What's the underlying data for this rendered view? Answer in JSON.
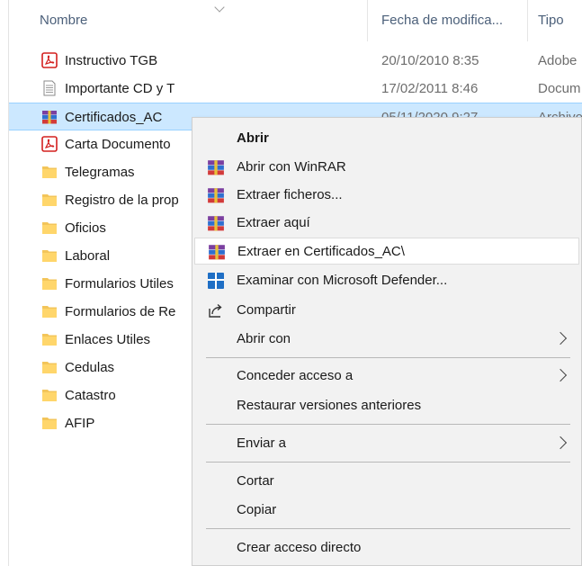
{
  "columns": {
    "name": "Nombre",
    "date": "Fecha de modifica...",
    "type": "Tipo"
  },
  "files": [
    {
      "name": "Instructivo TGB",
      "icon": "pdf-icon",
      "date": "20/10/2010 8:35",
      "type": "Adobe"
    },
    {
      "name": "Importante CD y T",
      "icon": "text-document-icon",
      "date": "17/02/2011 8:46",
      "type": "Docum"
    },
    {
      "name": "Certificados_AC",
      "icon": "winrar-archive-icon",
      "date": "05/11/2020 9:27",
      "type": "Archivo",
      "selected": true
    },
    {
      "name": "Carta Documento",
      "icon": "pdf-icon",
      "date": "",
      "type": ""
    },
    {
      "name": "Telegramas",
      "icon": "folder-icon",
      "date": "",
      "type": ""
    },
    {
      "name": "Registro de la prop",
      "icon": "folder-icon",
      "date": "",
      "type": ""
    },
    {
      "name": "Oficios",
      "icon": "folder-icon",
      "date": "",
      "type": ""
    },
    {
      "name": "Laboral",
      "icon": "folder-icon",
      "date": "",
      "type": ""
    },
    {
      "name": "Formularios Utiles",
      "icon": "folder-icon",
      "date": "",
      "type": ""
    },
    {
      "name": "Formularios de Re",
      "icon": "folder-icon",
      "date": "",
      "type": ""
    },
    {
      "name": "Enlaces Utiles",
      "icon": "folder-icon",
      "date": "",
      "type": ""
    },
    {
      "name": "Cedulas",
      "icon": "folder-icon",
      "date": "",
      "type": ""
    },
    {
      "name": "Catastro",
      "icon": "folder-icon",
      "date": "",
      "type": ""
    },
    {
      "name": "AFIP",
      "icon": "folder-icon",
      "date": "",
      "type": ""
    }
  ],
  "context_menu": {
    "items": [
      {
        "label": "Abrir",
        "bold": true,
        "icon": ""
      },
      {
        "label": "Abrir con WinRAR",
        "icon": "winrar-icon"
      },
      {
        "label": "Extraer ficheros...",
        "icon": "winrar-icon"
      },
      {
        "label": "Extraer aquí",
        "icon": "winrar-icon"
      },
      {
        "label": "Extraer en Certificados_AC\\",
        "icon": "winrar-icon",
        "hover": true
      },
      {
        "label": "Examinar con Microsoft Defender...",
        "icon": "defender-shield-icon"
      },
      {
        "label": "Compartir",
        "icon": "share-icon"
      },
      {
        "label": "Abrir con",
        "icon": "",
        "submenu": true
      },
      {
        "label": "Conceder acceso a",
        "icon": "",
        "submenu": true
      },
      {
        "label": "Restaurar versiones anteriores",
        "icon": ""
      },
      {
        "label": "Enviar a",
        "icon": "",
        "submenu": true
      },
      {
        "label": "Cortar",
        "icon": ""
      },
      {
        "label": "Copiar",
        "icon": ""
      },
      {
        "label": "Crear acceso directo",
        "icon": ""
      }
    ]
  },
  "colors": {
    "selection": "#cce8ff",
    "menu_background": "#f2f2f2",
    "pdf_red": "#d3201f",
    "folder_yellow": "#ffd66b",
    "column_header": "#4c607a"
  }
}
